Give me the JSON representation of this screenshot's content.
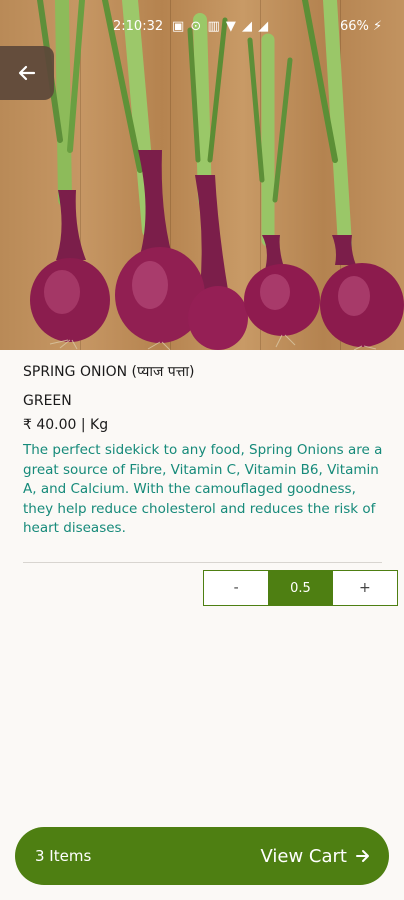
{
  "status_bar": {
    "time": "2:10:32",
    "icons": "▣ ⊙ ▥ ▼ ◢ ◢",
    "battery": "66% ⚡"
  },
  "product": {
    "image_alt": "spring onions on wooden table",
    "name": "SPRING ONION (प्याज पत्ता)",
    "variant": "GREEN",
    "price": "₹ 40.00 | Kg",
    "description": "The perfect sidekick to any food, Spring Onions are a great source of Fibre, Vitamin C, Vitamin B6, Vitamin A, and Calcium. With the camouflaged goodness, they help reduce cholesterol and reduces the risk of heart diseases."
  },
  "stepper": {
    "minus_label": "-",
    "quantity": "0.5",
    "plus_label": "+"
  },
  "cart": {
    "items_label": "3 Items",
    "view_label": "View Cart"
  },
  "colors": {
    "brand_green": "#4e7f12",
    "desc_teal": "#168a7a"
  }
}
